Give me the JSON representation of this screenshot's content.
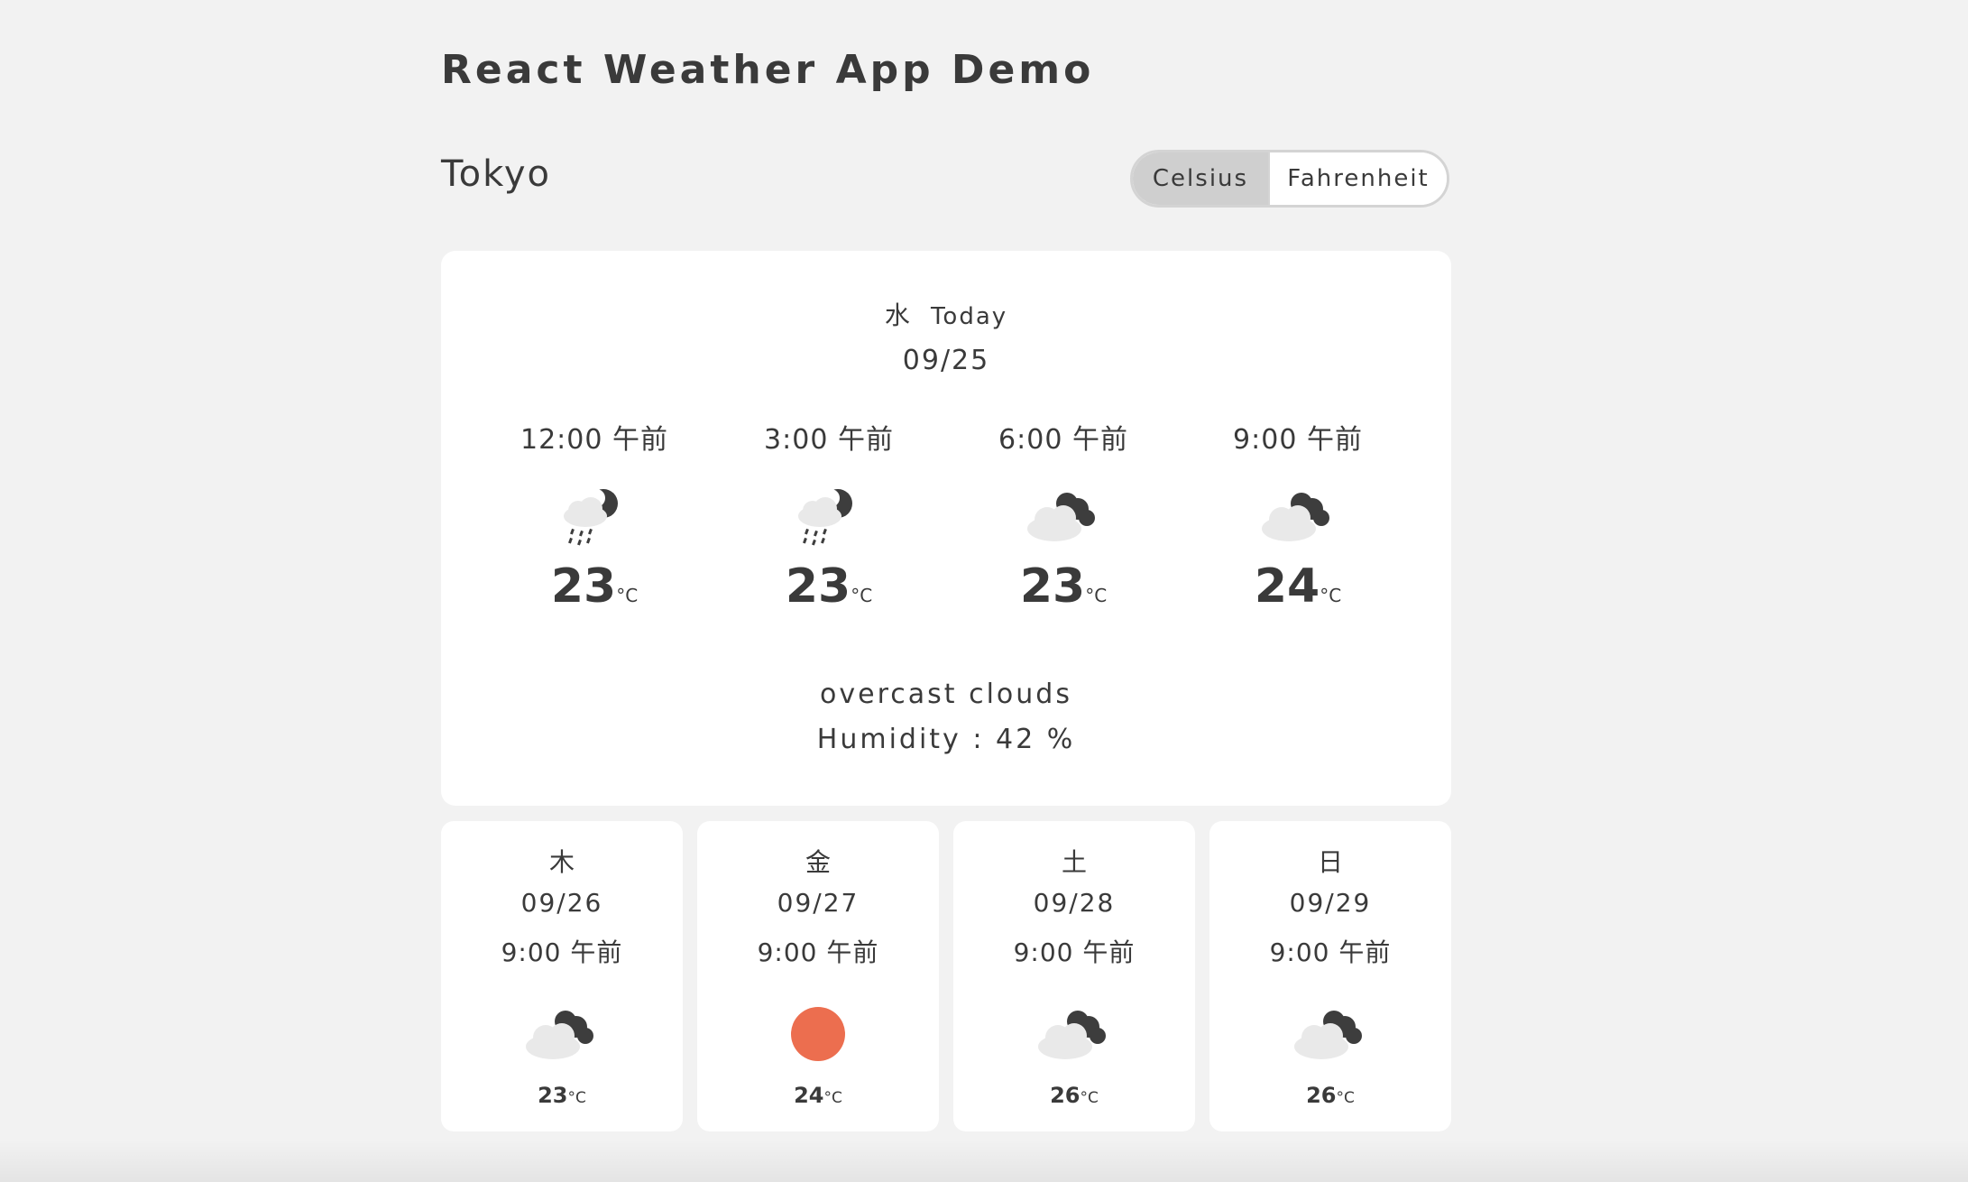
{
  "app": {
    "title": "React Weather App Demo"
  },
  "location": {
    "city": "Tokyo"
  },
  "units": {
    "celsius_label": "Celsius",
    "fahrenheit_label": "Fahrenheit",
    "selected": "Celsius"
  },
  "today": {
    "weekday": "水",
    "label": "Today",
    "date": "09/25",
    "description": "overcast clouds",
    "humidity_text": "Humidity : 42 %",
    "hours": [
      {
        "time": "12:00 午前",
        "icon": "rain-night-icon",
        "temp": "23",
        "unit": "°C"
      },
      {
        "time": "3:00 午前",
        "icon": "rain-night-icon",
        "temp": "23",
        "unit": "°C"
      },
      {
        "time": "6:00 午前",
        "icon": "cloudy-night-icon",
        "temp": "23",
        "unit": "°C"
      },
      {
        "time": "9:00 午前",
        "icon": "cloudy-night-icon",
        "temp": "24",
        "unit": "°C"
      }
    ]
  },
  "forecast": [
    {
      "weekday": "木",
      "date": "09/26",
      "time": "9:00 午前",
      "icon": "cloudy-night-icon",
      "temp": "23",
      "unit": "°C"
    },
    {
      "weekday": "金",
      "date": "09/27",
      "time": "9:00 午前",
      "icon": "sun-icon",
      "temp": "24",
      "unit": "°C"
    },
    {
      "weekday": "土",
      "date": "09/28",
      "time": "9:00 午前",
      "icon": "cloudy-night-icon",
      "temp": "26",
      "unit": "°C"
    },
    {
      "weekday": "日",
      "date": "09/29",
      "time": "9:00 午前",
      "icon": "cloudy-night-icon",
      "temp": "26",
      "unit": "°C"
    }
  ],
  "colors": {
    "background": "#f2f2f2",
    "card": "#ffffff",
    "text": "#3a3a3a",
    "cloud": "#e9e9e9",
    "moon": "#3d3d3d",
    "sun": "#ec6e4f",
    "toggle_active": "#cfcfcf"
  }
}
